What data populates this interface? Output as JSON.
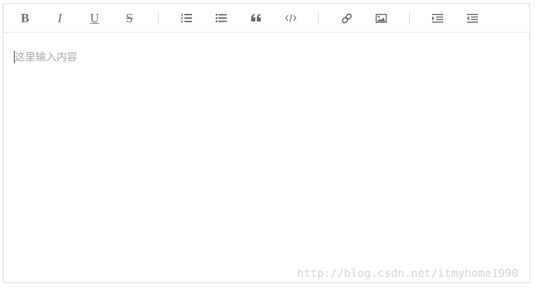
{
  "toolbar": {
    "bold": {
      "label": "B",
      "icon": "bold-icon"
    },
    "italic": {
      "label": "I",
      "icon": "italic-icon"
    },
    "underline": {
      "label": "U",
      "icon": "underline-icon"
    },
    "strikethrough": {
      "label": "S",
      "icon": "strikethrough-icon"
    },
    "ordered_list": {
      "icon": "ordered-list-icon"
    },
    "unordered_list": {
      "icon": "unordered-list-icon"
    },
    "blockquote": {
      "icon": "quote-icon"
    },
    "code": {
      "icon": "code-icon"
    },
    "link": {
      "icon": "link-icon"
    },
    "image": {
      "icon": "image-icon"
    },
    "indent": {
      "icon": "indent-icon"
    },
    "outdent": {
      "icon": "outdent-icon"
    }
  },
  "editor": {
    "placeholder": "这里输入内容"
  },
  "watermark": {
    "text": "http://blog.csdn.net/itmyhome1990"
  },
  "colors": {
    "icon": "#6b6b6b",
    "border": "#d9d9d9",
    "placeholder": "#a6a6a6",
    "watermark": "#d4d4d4"
  }
}
